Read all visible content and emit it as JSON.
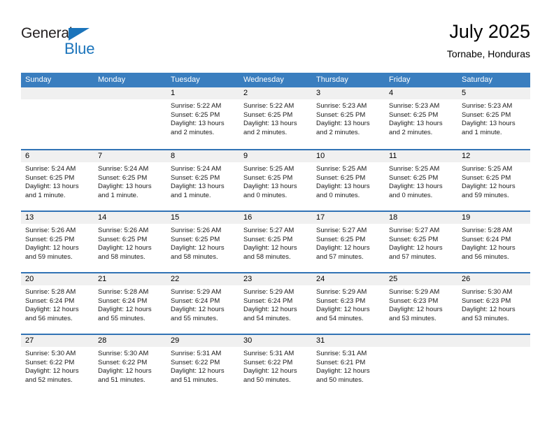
{
  "brand": {
    "name_top": "General",
    "name_bottom": "Blue",
    "triangle_color": "#1b74bb"
  },
  "header": {
    "title": "July 2025",
    "subtitle": "Tornabe, Honduras"
  },
  "theme": {
    "header_blue": "#3a7ebf",
    "rule_blue": "#3273b5",
    "daynum_band": "#f0f0f0",
    "text": "#000000"
  },
  "weekdays": [
    "Sunday",
    "Monday",
    "Tuesday",
    "Wednesday",
    "Thursday",
    "Friday",
    "Saturday"
  ],
  "labels": {
    "sunrise_prefix": "Sunrise: ",
    "sunset_prefix": "Sunset: ",
    "daylight_prefix": "Daylight: "
  },
  "weeks": [
    [
      {
        "day": "",
        "sunrise": "",
        "sunset": "",
        "daylight": ""
      },
      {
        "day": "",
        "sunrise": "",
        "sunset": "",
        "daylight": ""
      },
      {
        "day": "1",
        "sunrise": "Sunrise: 5:22 AM",
        "sunset": "Sunset: 6:25 PM",
        "daylight": "Daylight: 13 hours and 2 minutes."
      },
      {
        "day": "2",
        "sunrise": "Sunrise: 5:22 AM",
        "sunset": "Sunset: 6:25 PM",
        "daylight": "Daylight: 13 hours and 2 minutes."
      },
      {
        "day": "3",
        "sunrise": "Sunrise: 5:23 AM",
        "sunset": "Sunset: 6:25 PM",
        "daylight": "Daylight: 13 hours and 2 minutes."
      },
      {
        "day": "4",
        "sunrise": "Sunrise: 5:23 AM",
        "sunset": "Sunset: 6:25 PM",
        "daylight": "Daylight: 13 hours and 2 minutes."
      },
      {
        "day": "5",
        "sunrise": "Sunrise: 5:23 AM",
        "sunset": "Sunset: 6:25 PM",
        "daylight": "Daylight: 13 hours and 1 minute."
      }
    ],
    [
      {
        "day": "6",
        "sunrise": "Sunrise: 5:24 AM",
        "sunset": "Sunset: 6:25 PM",
        "daylight": "Daylight: 13 hours and 1 minute."
      },
      {
        "day": "7",
        "sunrise": "Sunrise: 5:24 AM",
        "sunset": "Sunset: 6:25 PM",
        "daylight": "Daylight: 13 hours and 1 minute."
      },
      {
        "day": "8",
        "sunrise": "Sunrise: 5:24 AM",
        "sunset": "Sunset: 6:25 PM",
        "daylight": "Daylight: 13 hours and 1 minute."
      },
      {
        "day": "9",
        "sunrise": "Sunrise: 5:25 AM",
        "sunset": "Sunset: 6:25 PM",
        "daylight": "Daylight: 13 hours and 0 minutes."
      },
      {
        "day": "10",
        "sunrise": "Sunrise: 5:25 AM",
        "sunset": "Sunset: 6:25 PM",
        "daylight": "Daylight: 13 hours and 0 minutes."
      },
      {
        "day": "11",
        "sunrise": "Sunrise: 5:25 AM",
        "sunset": "Sunset: 6:25 PM",
        "daylight": "Daylight: 13 hours and 0 minutes."
      },
      {
        "day": "12",
        "sunrise": "Sunrise: 5:25 AM",
        "sunset": "Sunset: 6:25 PM",
        "daylight": "Daylight: 12 hours and 59 minutes."
      }
    ],
    [
      {
        "day": "13",
        "sunrise": "Sunrise: 5:26 AM",
        "sunset": "Sunset: 6:25 PM",
        "daylight": "Daylight: 12 hours and 59 minutes."
      },
      {
        "day": "14",
        "sunrise": "Sunrise: 5:26 AM",
        "sunset": "Sunset: 6:25 PM",
        "daylight": "Daylight: 12 hours and 58 minutes."
      },
      {
        "day": "15",
        "sunrise": "Sunrise: 5:26 AM",
        "sunset": "Sunset: 6:25 PM",
        "daylight": "Daylight: 12 hours and 58 minutes."
      },
      {
        "day": "16",
        "sunrise": "Sunrise: 5:27 AM",
        "sunset": "Sunset: 6:25 PM",
        "daylight": "Daylight: 12 hours and 58 minutes."
      },
      {
        "day": "17",
        "sunrise": "Sunrise: 5:27 AM",
        "sunset": "Sunset: 6:25 PM",
        "daylight": "Daylight: 12 hours and 57 minutes."
      },
      {
        "day": "18",
        "sunrise": "Sunrise: 5:27 AM",
        "sunset": "Sunset: 6:25 PM",
        "daylight": "Daylight: 12 hours and 57 minutes."
      },
      {
        "day": "19",
        "sunrise": "Sunrise: 5:28 AM",
        "sunset": "Sunset: 6:24 PM",
        "daylight": "Daylight: 12 hours and 56 minutes."
      }
    ],
    [
      {
        "day": "20",
        "sunrise": "Sunrise: 5:28 AM",
        "sunset": "Sunset: 6:24 PM",
        "daylight": "Daylight: 12 hours and 56 minutes."
      },
      {
        "day": "21",
        "sunrise": "Sunrise: 5:28 AM",
        "sunset": "Sunset: 6:24 PM",
        "daylight": "Daylight: 12 hours and 55 minutes."
      },
      {
        "day": "22",
        "sunrise": "Sunrise: 5:29 AM",
        "sunset": "Sunset: 6:24 PM",
        "daylight": "Daylight: 12 hours and 55 minutes."
      },
      {
        "day": "23",
        "sunrise": "Sunrise: 5:29 AM",
        "sunset": "Sunset: 6:24 PM",
        "daylight": "Daylight: 12 hours and 54 minutes."
      },
      {
        "day": "24",
        "sunrise": "Sunrise: 5:29 AM",
        "sunset": "Sunset: 6:23 PM",
        "daylight": "Daylight: 12 hours and 54 minutes."
      },
      {
        "day": "25",
        "sunrise": "Sunrise: 5:29 AM",
        "sunset": "Sunset: 6:23 PM",
        "daylight": "Daylight: 12 hours and 53 minutes."
      },
      {
        "day": "26",
        "sunrise": "Sunrise: 5:30 AM",
        "sunset": "Sunset: 6:23 PM",
        "daylight": "Daylight: 12 hours and 53 minutes."
      }
    ],
    [
      {
        "day": "27",
        "sunrise": "Sunrise: 5:30 AM",
        "sunset": "Sunset: 6:22 PM",
        "daylight": "Daylight: 12 hours and 52 minutes."
      },
      {
        "day": "28",
        "sunrise": "Sunrise: 5:30 AM",
        "sunset": "Sunset: 6:22 PM",
        "daylight": "Daylight: 12 hours and 51 minutes."
      },
      {
        "day": "29",
        "sunrise": "Sunrise: 5:31 AM",
        "sunset": "Sunset: 6:22 PM",
        "daylight": "Daylight: 12 hours and 51 minutes."
      },
      {
        "day": "30",
        "sunrise": "Sunrise: 5:31 AM",
        "sunset": "Sunset: 6:22 PM",
        "daylight": "Daylight: 12 hours and 50 minutes."
      },
      {
        "day": "31",
        "sunrise": "Sunrise: 5:31 AM",
        "sunset": "Sunset: 6:21 PM",
        "daylight": "Daylight: 12 hours and 50 minutes."
      },
      {
        "day": "",
        "sunrise": "",
        "sunset": "",
        "daylight": ""
      },
      {
        "day": "",
        "sunrise": "",
        "sunset": "",
        "daylight": ""
      }
    ]
  ]
}
